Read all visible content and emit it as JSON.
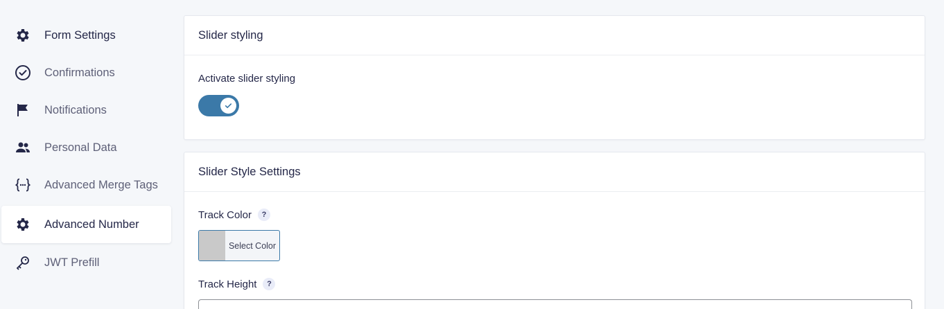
{
  "sidebar": {
    "items": [
      {
        "label": "Form Settings",
        "icon": "gear-icon"
      },
      {
        "label": "Confirmations",
        "icon": "check-circle-icon"
      },
      {
        "label": "Notifications",
        "icon": "flag-icon"
      },
      {
        "label": "Personal Data",
        "icon": "users-icon"
      },
      {
        "label": "Advanced Merge Tags",
        "icon": "braces-icon"
      },
      {
        "label": "Advanced Number",
        "icon": "gear-icon",
        "active": true
      },
      {
        "label": "JWT Prefill",
        "icon": "key-icon"
      }
    ]
  },
  "slider_styling": {
    "title": "Slider styling",
    "activate_label": "Activate slider styling",
    "activate_on": true
  },
  "slider_style_settings": {
    "title": "Slider Style Settings",
    "track_color_label": "Track Color",
    "track_color_help": "?",
    "select_color_label": "Select Color",
    "track_color_value": "#c9c9c9",
    "track_height_label": "Track Height",
    "track_height_help": "?"
  },
  "colors": {
    "accent": "#3b79a8",
    "text": "#242748",
    "background": "#f5f7fa"
  }
}
